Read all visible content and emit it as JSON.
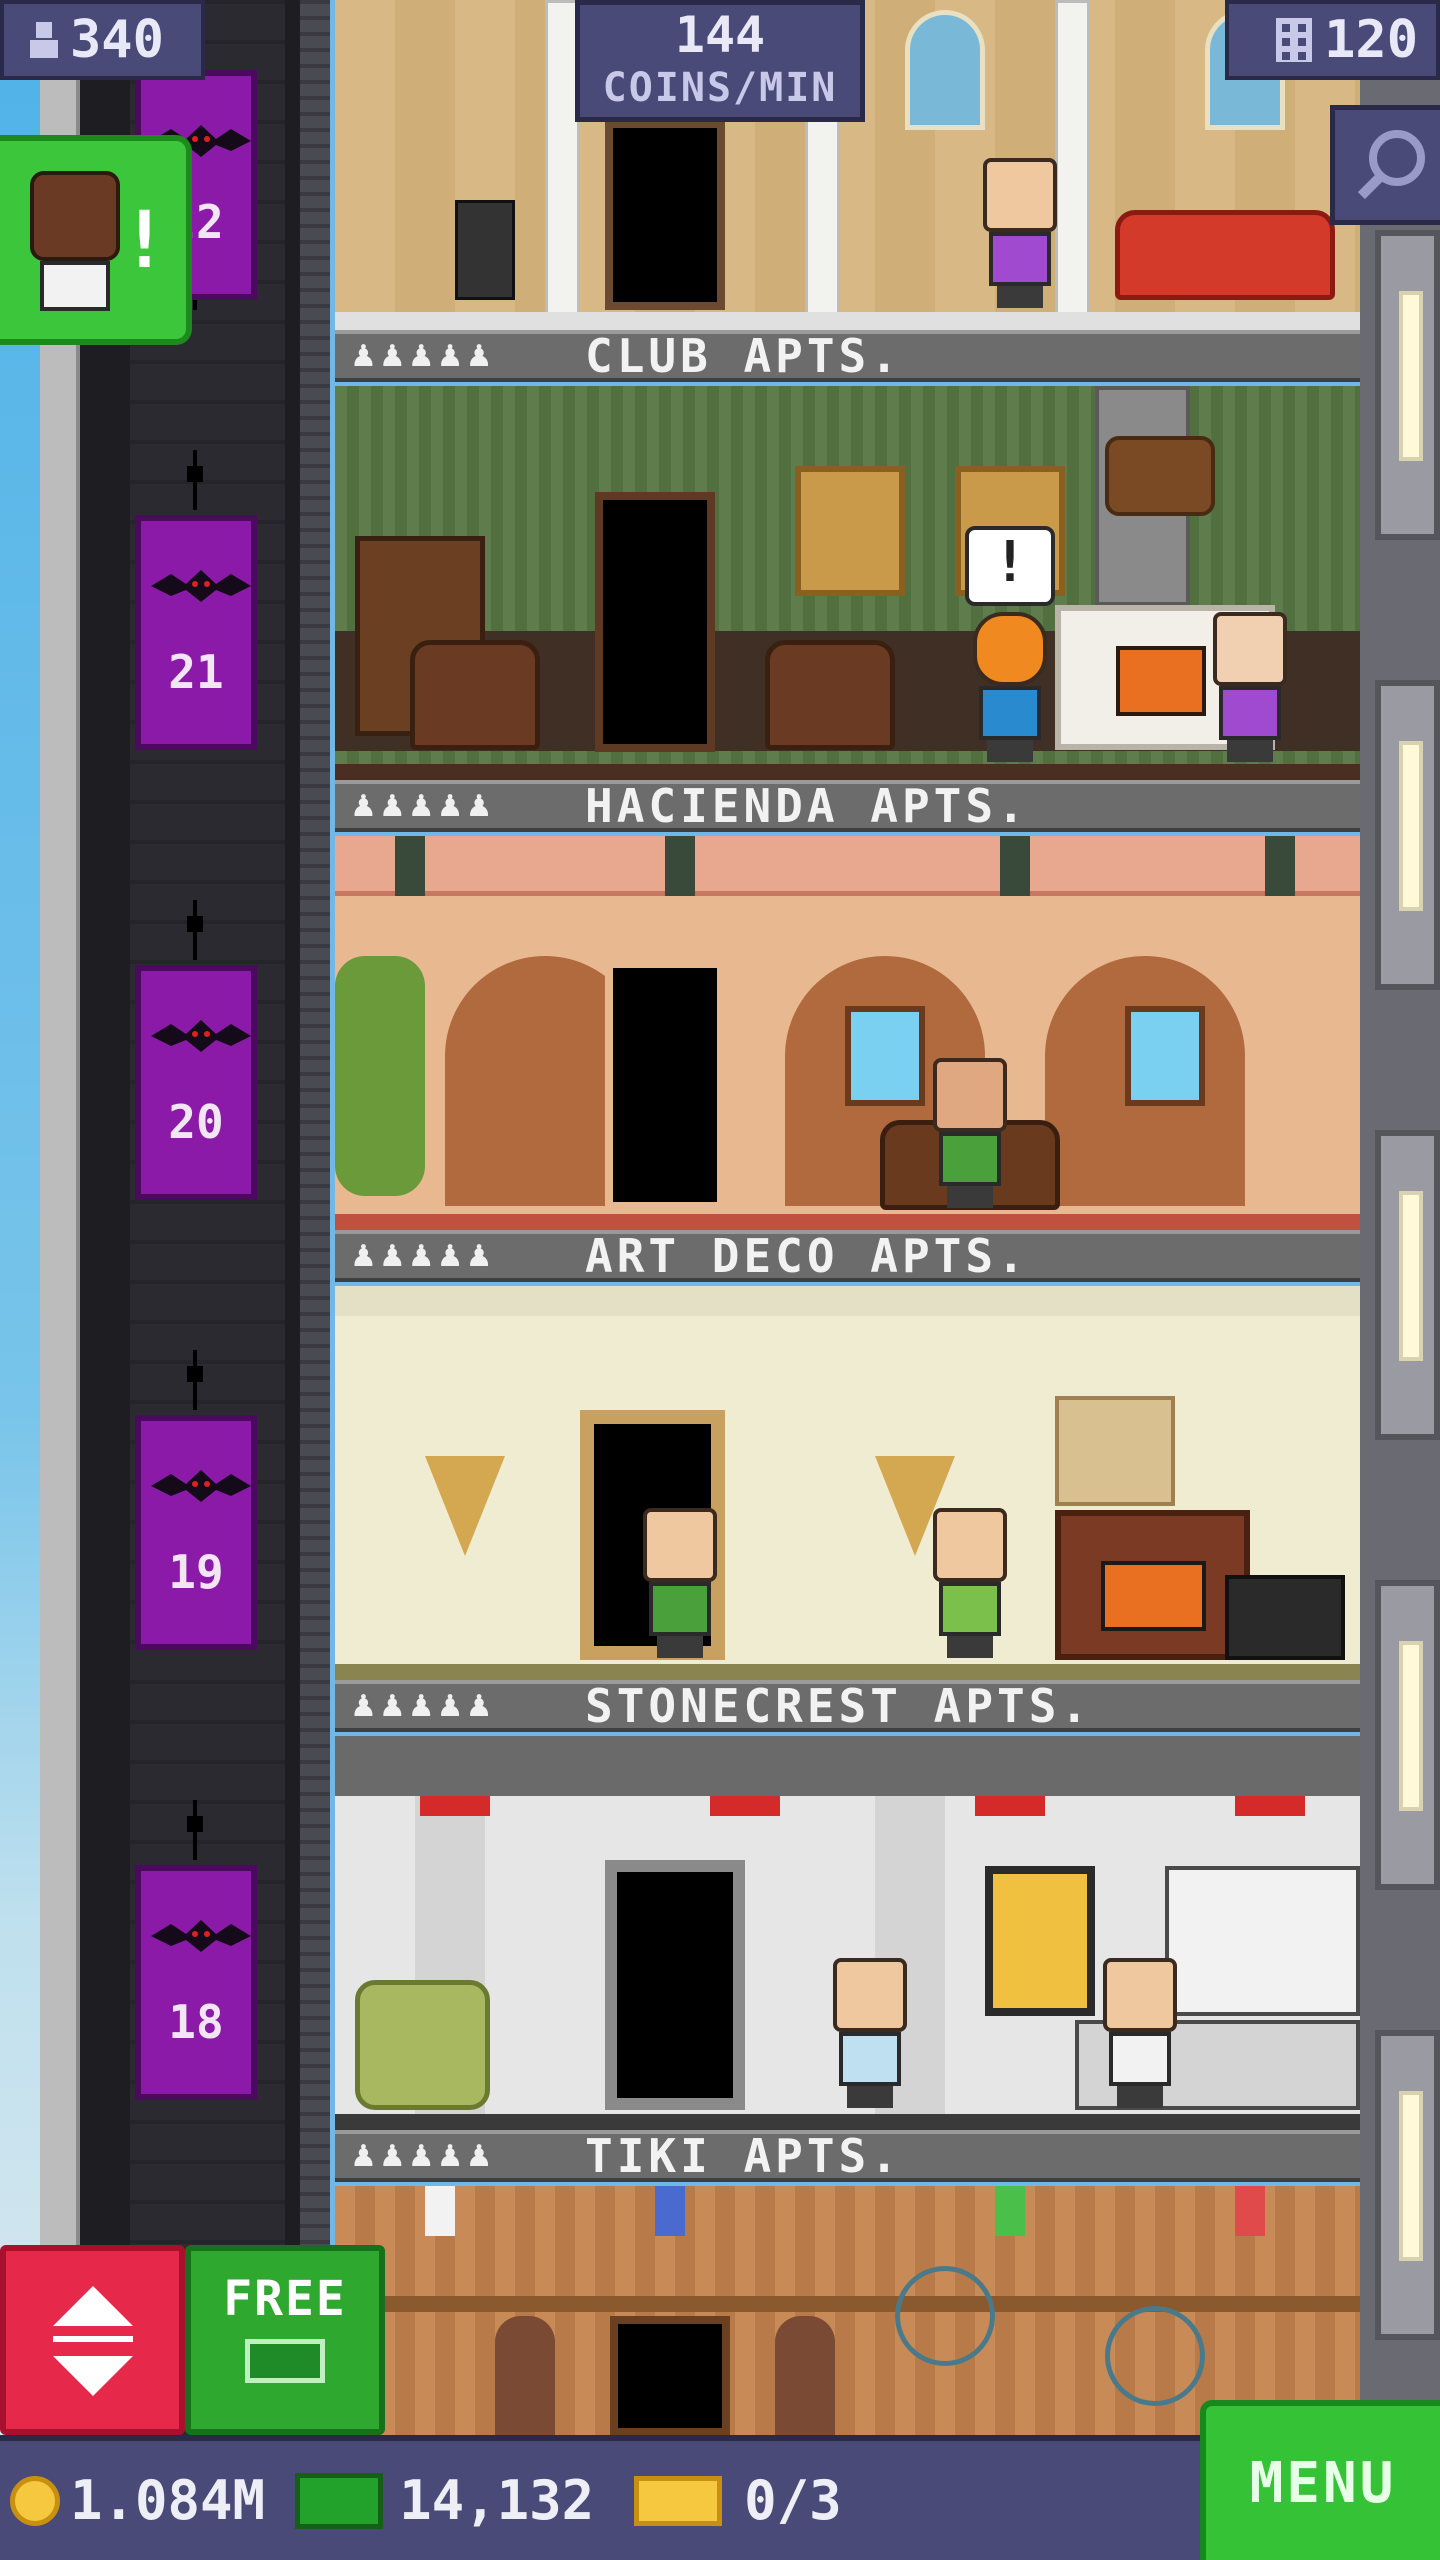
{
  "hud": {
    "population": "340",
    "coins_per_min_value": "144",
    "coins_per_min_label": "COINS/MIN",
    "floor_count": "120"
  },
  "elevator_stops": [
    {
      "num": "22"
    },
    {
      "num": "21"
    },
    {
      "num": "20"
    },
    {
      "num": "19"
    },
    {
      "num": "18"
    }
  ],
  "floors": [
    {
      "name": "CLUB APTS.",
      "stars": "♟♟♟♟♟",
      "wall": "#d6b680",
      "trim": "#c09a60"
    },
    {
      "name": "HACIENDA APTS.",
      "stars": "♟♟♟♟♟",
      "wall": "#5d7a4c",
      "trim": "#3f2f24"
    },
    {
      "name": "ART DECO APTS.",
      "stars": "♟♟♟♟♟",
      "wall": "#e8b890",
      "trim": "#b06a3e"
    },
    {
      "name": "STONECREST APTS.",
      "stars": "♟♟♟♟♟",
      "wall": "#f0ecd2",
      "trim": "#d4c890"
    },
    {
      "name": "TIKI APTS.",
      "stars": "♟♟♟♟♟",
      "wall": "#e6e6e6",
      "trim": "#4a4a4a"
    }
  ],
  "buttons": {
    "free": "FREE",
    "menu": "MENU"
  },
  "currency": {
    "coins": "1.084M",
    "bux": "14,132",
    "tickets": "0/3"
  },
  "colors": {
    "hud_bg": "#4a4a78",
    "elevator": "#8c1aa8",
    "menu_green": "#36c236",
    "elevator_btn_red": "#e6284a"
  }
}
